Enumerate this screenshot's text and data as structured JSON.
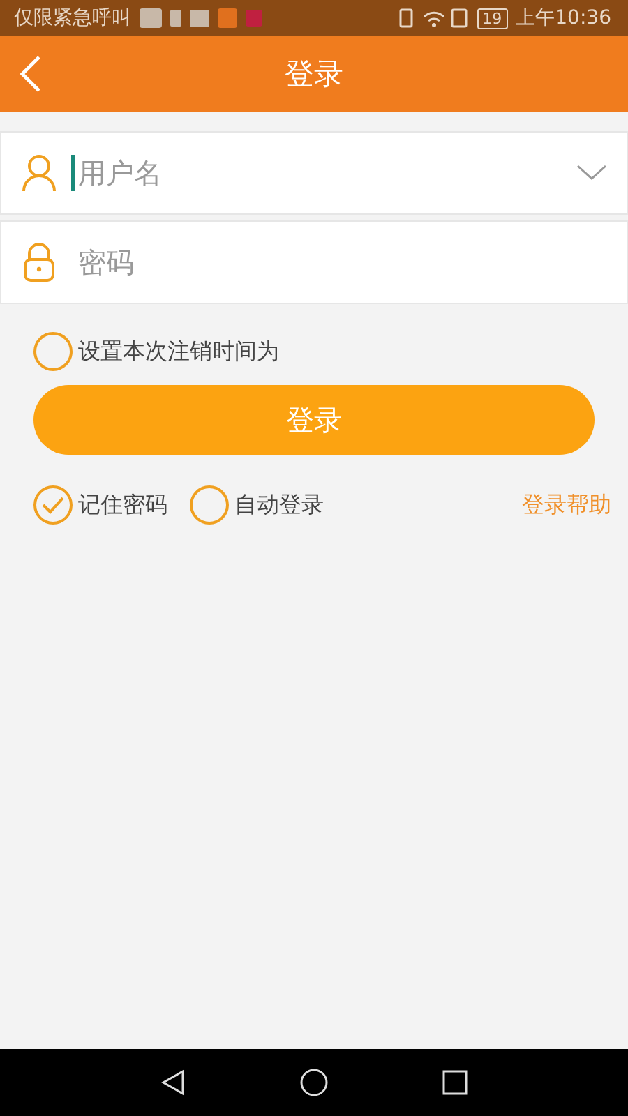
{
  "status_bar": {
    "carrier": "仅限紧急呼叫",
    "battery": "19",
    "time": "上午10:36"
  },
  "header": {
    "title": "登录"
  },
  "fields": [
    {
      "kind": "user",
      "placeholder": "用户名",
      "focused": true,
      "dropdown": true
    },
    {
      "kind": "lock",
      "placeholder": "密码",
      "focused": false,
      "dropdown": false
    }
  ],
  "logout_option": {
    "label": "设置本次注销时间为",
    "checked": false
  },
  "login_button": "登录",
  "options": [
    {
      "label": "记住密码",
      "checked": true
    },
    {
      "label": "自动登录",
      "checked": false
    }
  ],
  "help_link": "登录帮助"
}
